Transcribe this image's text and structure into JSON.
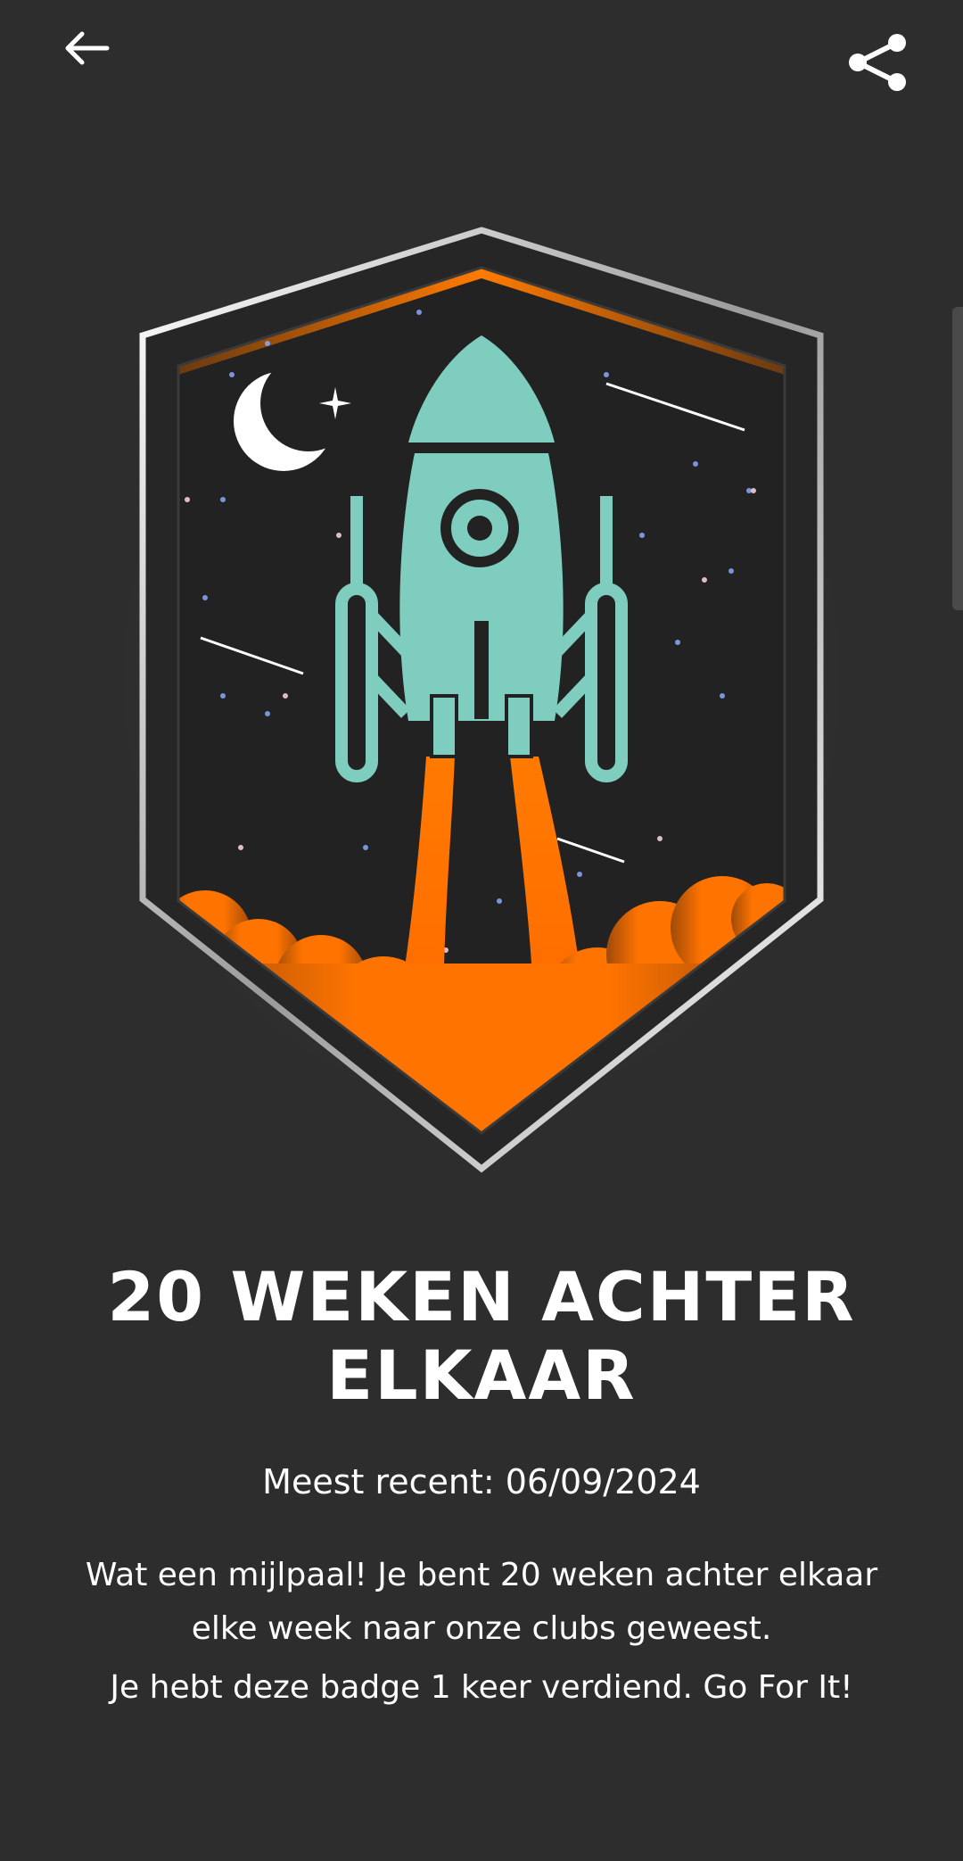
{
  "header": {
    "back_icon": "arrow-left-icon",
    "share_icon": "share-icon"
  },
  "badge": {
    "name": "rocket-launch-shield",
    "colors": {
      "rocket": "#7ecdbe",
      "flame": "#ff7a00",
      "frame": "#ffffff",
      "sky": "#222222"
    }
  },
  "content": {
    "title_line1": "20 WEKEN ACHTER",
    "title_line2": "ELKAAR",
    "most_recent": "Meest recent: 06/09/2024",
    "description_line1": "Wat een mijlpaal! Je bent 20 weken achter elkaar elke week naar onze clubs geweest.",
    "description_line2": "Je hebt deze badge 1 keer verdiend. Go For It!"
  }
}
